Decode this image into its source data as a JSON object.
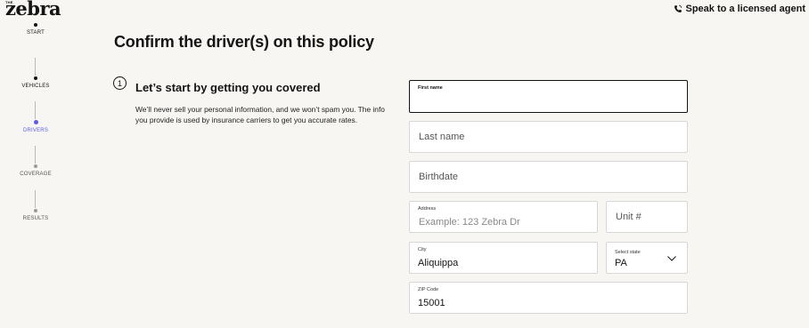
{
  "header": {
    "logo_small": "THE",
    "logo": "zebra",
    "agent_link": "Speak to a licensed agent"
  },
  "stepper": {
    "steps": [
      {
        "label": "START",
        "state": "done"
      },
      {
        "label": "VEHICLES",
        "state": "done"
      },
      {
        "label": "DRIVERS",
        "state": "active"
      },
      {
        "label": "COVERAGE",
        "state": "pending"
      },
      {
        "label": "RESULTS",
        "state": "pending"
      }
    ]
  },
  "main": {
    "title": "Confirm the driver(s) on this policy",
    "section": {
      "number": "1",
      "title": "Let’s start by getting you covered",
      "description": "We’ll never sell your personal information, and we won’t spam you. The info you provide is used by insurance carriers to get you accurate rates."
    }
  },
  "form": {
    "first_name": {
      "label": "First name",
      "value": ""
    },
    "last_name": {
      "placeholder": "Last name"
    },
    "birthdate": {
      "placeholder": "Birthdate"
    },
    "address": {
      "label": "Address",
      "placeholder": "Example: 123 Zebra Dr"
    },
    "unit": {
      "placeholder": "Unit #"
    },
    "city": {
      "label": "City",
      "value": "Aliquippa"
    },
    "state": {
      "label": "Select state",
      "value": "PA"
    },
    "zip": {
      "label": "ZIP Code",
      "value": "15001"
    }
  }
}
